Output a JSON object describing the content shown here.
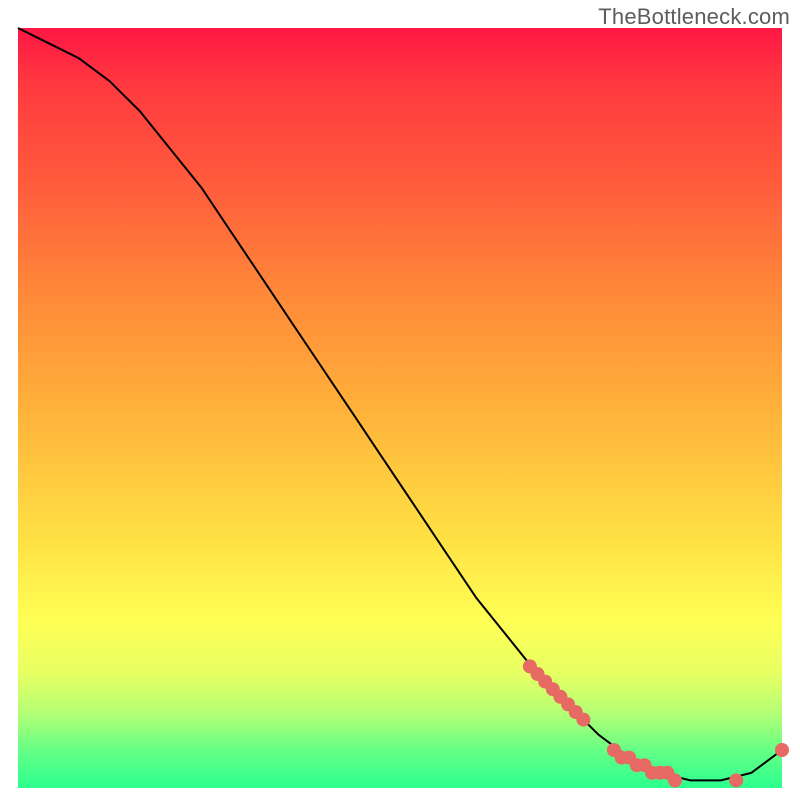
{
  "watermark": "TheBottleneck.com",
  "colors": {
    "gradient_top": "#ff1744",
    "gradient_mid_orange": "#ff8939",
    "gradient_mid_yellow": "#ffe345",
    "gradient_bottom": "#2cff8e",
    "curve": "#000000",
    "dot_fill": "#e66a63"
  },
  "chart_data": {
    "type": "line",
    "title": "",
    "xlabel": "",
    "ylabel": "",
    "xlim": [
      0,
      100
    ],
    "ylim": [
      0,
      100
    ],
    "x": [
      0,
      4,
      8,
      12,
      16,
      20,
      24,
      28,
      32,
      36,
      40,
      44,
      48,
      52,
      56,
      60,
      64,
      68,
      72,
      76,
      80,
      84,
      88,
      92,
      96,
      100
    ],
    "y": [
      100,
      98,
      96,
      93,
      89,
      84,
      79,
      73,
      67,
      61,
      55,
      49,
      43,
      37,
      31,
      25,
      20,
      15,
      11,
      7,
      4,
      2,
      1,
      1,
      2,
      5
    ],
    "markers": {
      "x": [
        67,
        68,
        69,
        70,
        71,
        72,
        73,
        74,
        78,
        79,
        80,
        81,
        82,
        83,
        84,
        85,
        86,
        94,
        100
      ],
      "y": [
        16,
        15,
        14,
        13,
        12,
        11,
        10,
        9,
        5,
        4,
        4,
        3,
        3,
        2,
        2,
        2,
        1,
        1,
        5
      ]
    }
  }
}
